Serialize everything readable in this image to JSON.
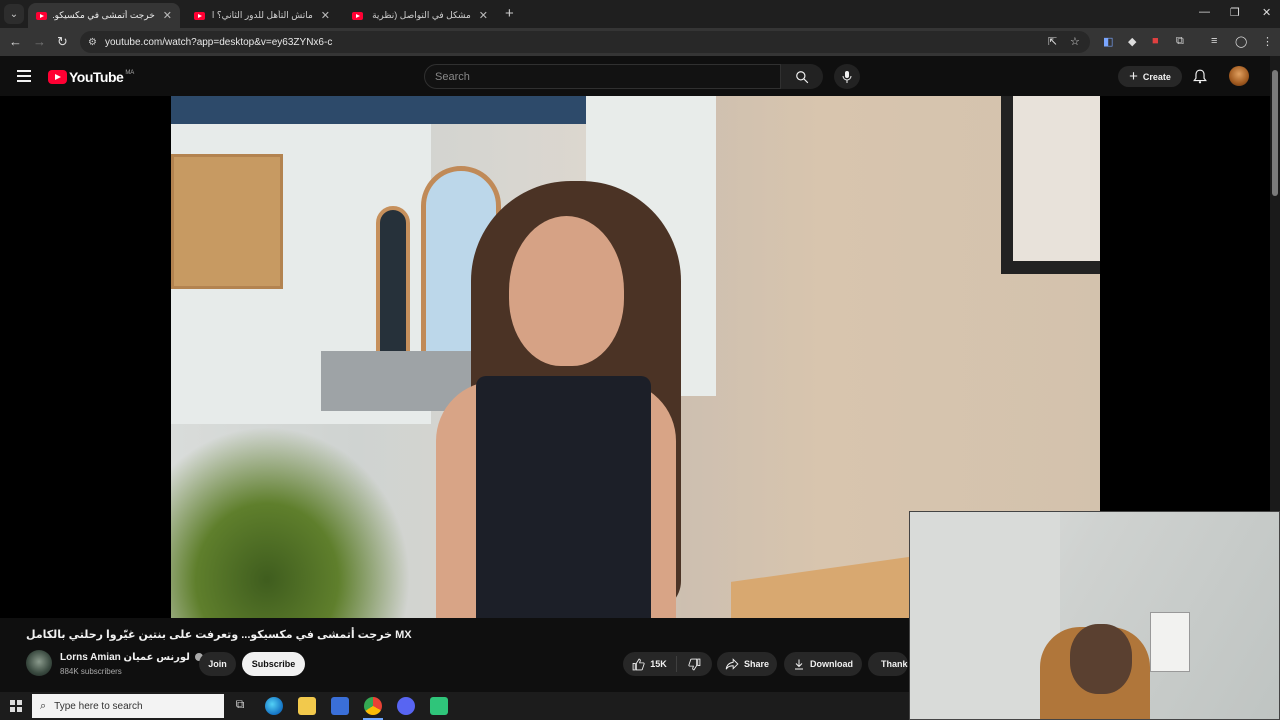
{
  "browser": {
    "tabs": [
      {
        "title": "خرجت أتمشى في مكسيكو...",
        "active": true
      },
      {
        "title": "ماتش التأهل للدور الثاني؟ التشكيلة",
        "active": false
      },
      {
        "title": "مشكل في التواصل (نظرية البراكين",
        "active": false
      }
    ],
    "url": "youtube.com/watch?app=desktop&v=ey63ZYNx6-c"
  },
  "youtube": {
    "logo_text": "YouTube",
    "country_code": "MA",
    "search_placeholder": "Search",
    "create_label": "Create"
  },
  "video": {
    "title": "خرجت أتمشى في مكسيكو... وتعرفت على بنتين غيّروا رحلتي بالكامل MX",
    "channel_name": "Lorns Amian لورنس عميان",
    "subscribers": "884K subscribers",
    "join_label": "Join",
    "subscribe_label": "Subscribe",
    "likes": "15K",
    "share_label": "Share",
    "download_label": "Download",
    "thanks_label": "Thanks"
  },
  "taskbar": {
    "search_placeholder": "Type here to search"
  },
  "colors": {
    "youtube_red": "#ff0033",
    "background": "#0f0f0f",
    "pill": "#272727"
  }
}
